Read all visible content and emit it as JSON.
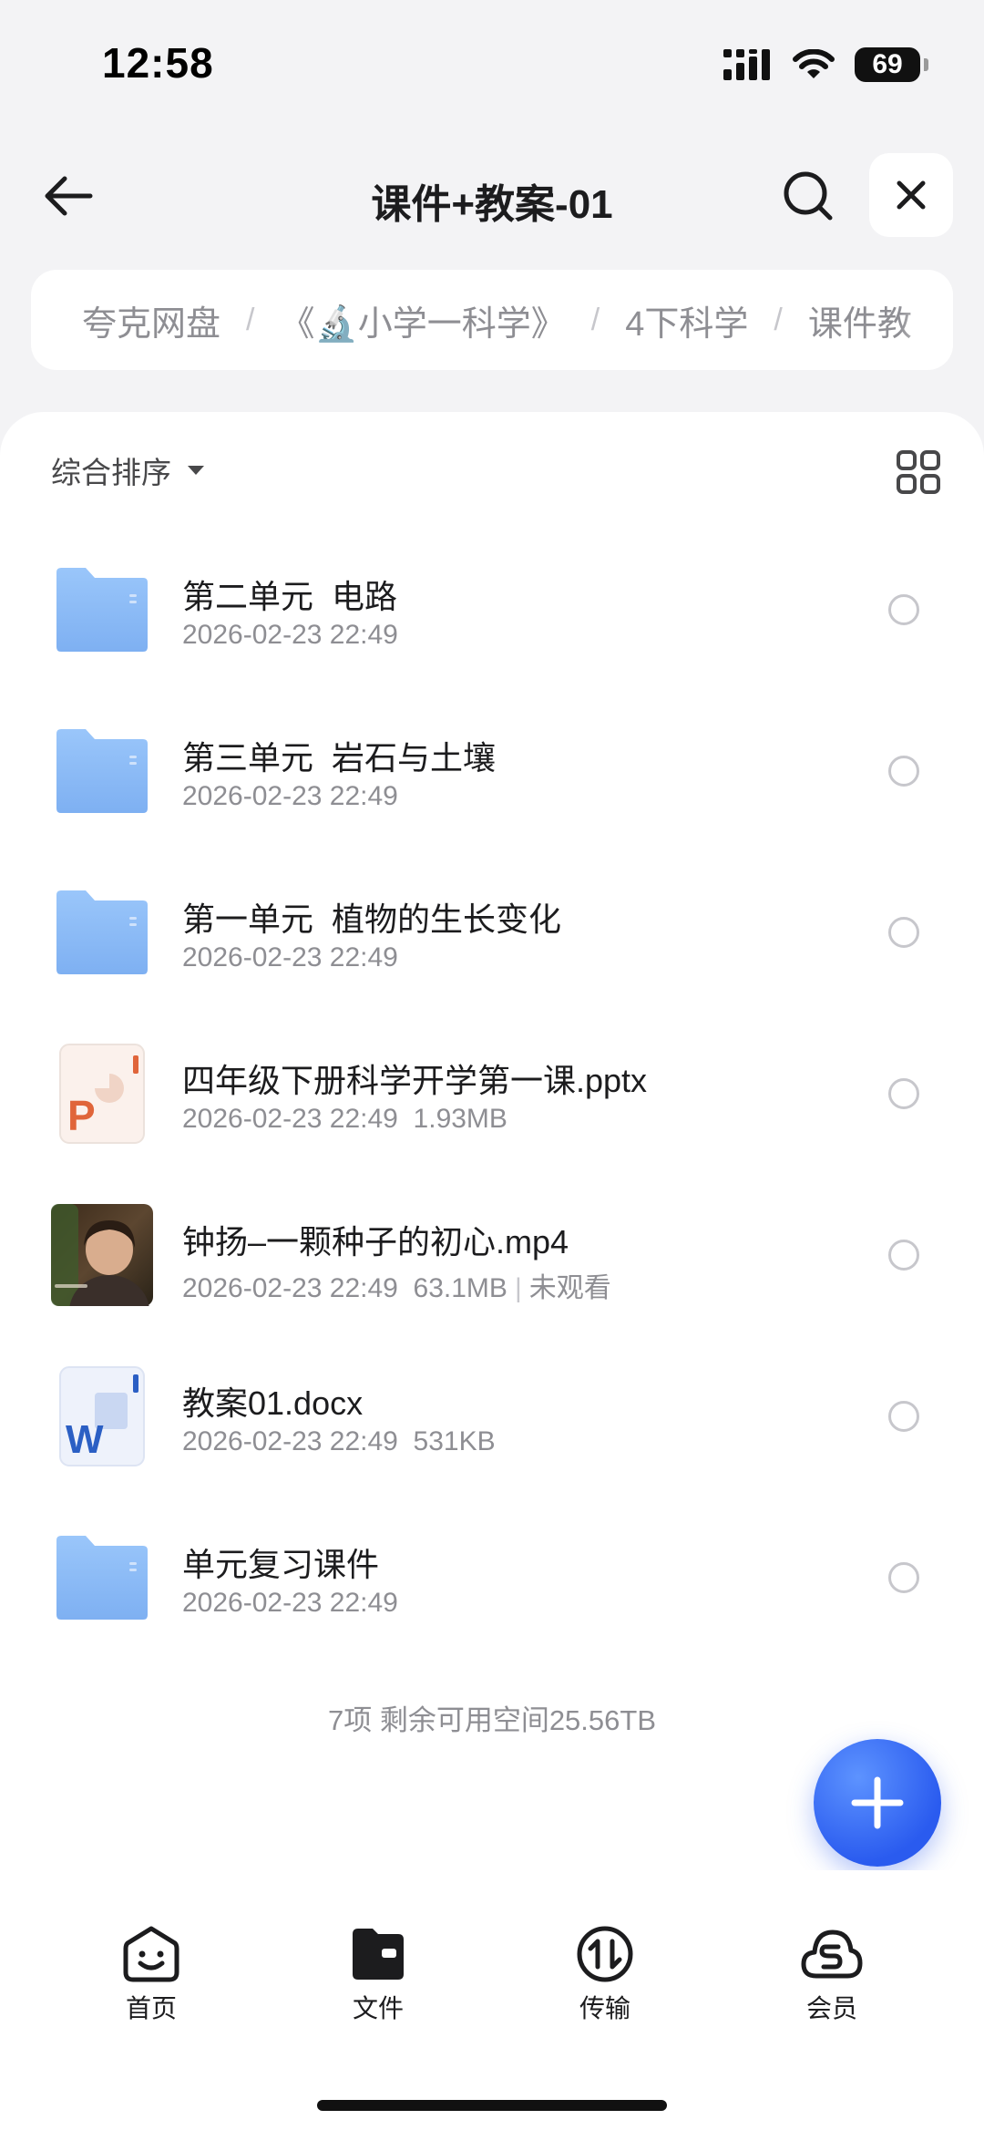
{
  "status_bar": {
    "time": "12:58",
    "battery": "69"
  },
  "header": {
    "title": "课件+教案-01"
  },
  "breadcrumb": [
    "夸克网盘",
    "《🔬小学一科学》",
    "4下科学",
    "课件教"
  ],
  "toolbar": {
    "sort_label": "综合排序"
  },
  "files": [
    {
      "name": "第二单元  电路",
      "date": "2026-02-23 22:49",
      "size": "",
      "extra": "",
      "type": "folder"
    },
    {
      "name": "第三单元  岩石与土壤",
      "date": "2026-02-23 22:49",
      "size": "",
      "extra": "",
      "type": "folder"
    },
    {
      "name": "第一单元  植物的生长变化",
      "date": "2026-02-23 22:49",
      "size": "",
      "extra": "",
      "type": "folder"
    },
    {
      "name": "四年级下册科学开学第一课.pptx",
      "date": "2026-02-23 22:49",
      "size": "1.93MB",
      "extra": "",
      "type": "pptx"
    },
    {
      "name": "钟扬–一颗种子的初心.mp4",
      "date": "2026-02-23 22:49",
      "size": "63.1MB",
      "extra": "未观看",
      "type": "video"
    },
    {
      "name": "教案01.docx",
      "date": "2026-02-23 22:49",
      "size": "531KB",
      "extra": "",
      "type": "docx"
    },
    {
      "name": "单元复习课件",
      "date": "2026-02-23 22:49",
      "size": "",
      "extra": "",
      "type": "folder"
    }
  ],
  "summary": "7项 剩余可用空间25.56TB",
  "tabs": [
    {
      "label": "首页",
      "icon": "home-face-icon"
    },
    {
      "label": "文件",
      "icon": "folder-icon"
    },
    {
      "label": "传输",
      "icon": "transfer-icon"
    },
    {
      "label": "会员",
      "icon": "cloud-member-icon"
    }
  ],
  "colors": {
    "accent": "#2a5bef",
    "folder": "#8fbcf5",
    "ppt": "#e0653a",
    "word": "#2b5fc4"
  }
}
